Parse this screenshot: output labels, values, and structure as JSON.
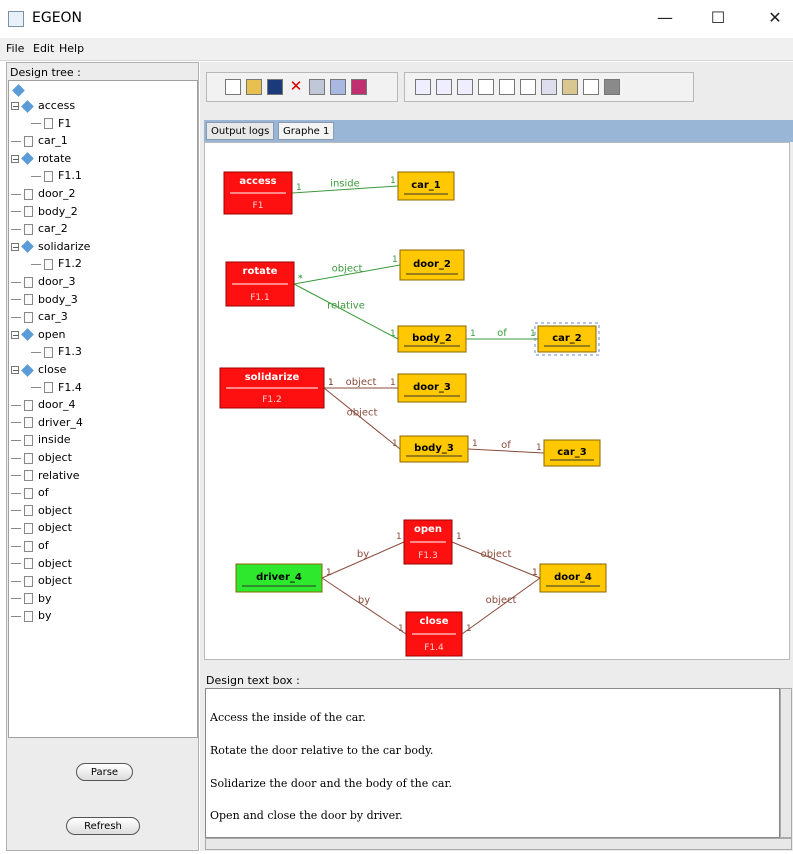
{
  "window": {
    "title": "EGEON",
    "minimize": "—",
    "maximize": "☐",
    "close": "✕"
  },
  "menu": {
    "file": "File",
    "edit": "Edit",
    "help": "Help"
  },
  "left": {
    "label": "Design tree :",
    "tree": [
      {
        "text": "access",
        "kind": "folder",
        "level": 1,
        "expanded": true
      },
      {
        "text": "F1",
        "kind": "doc",
        "level": 2
      },
      {
        "text": "car_1",
        "kind": "doc",
        "level": 1
      },
      {
        "text": "rotate",
        "kind": "folder",
        "level": 1,
        "expanded": true
      },
      {
        "text": "F1.1",
        "kind": "doc",
        "level": 2
      },
      {
        "text": "door_2",
        "kind": "doc",
        "level": 1
      },
      {
        "text": "body_2",
        "kind": "doc",
        "level": 1
      },
      {
        "text": "car_2",
        "kind": "doc",
        "level": 1
      },
      {
        "text": "solidarize",
        "kind": "folder",
        "level": 1,
        "expanded": true
      },
      {
        "text": "F1.2",
        "kind": "doc",
        "level": 2
      },
      {
        "text": "door_3",
        "kind": "doc",
        "level": 1
      },
      {
        "text": "body_3",
        "kind": "doc",
        "level": 1
      },
      {
        "text": "car_3",
        "kind": "doc",
        "level": 1
      },
      {
        "text": "open",
        "kind": "folder",
        "level": 1,
        "expanded": true
      },
      {
        "text": "F1.3",
        "kind": "doc",
        "level": 2
      },
      {
        "text": "close",
        "kind": "folder",
        "level": 1,
        "expanded": true
      },
      {
        "text": "F1.4",
        "kind": "doc",
        "level": 2
      },
      {
        "text": "door_4",
        "kind": "doc",
        "level": 1
      },
      {
        "text": "driver_4",
        "kind": "doc",
        "level": 1
      },
      {
        "text": "inside",
        "kind": "doc",
        "level": 1
      },
      {
        "text": "object",
        "kind": "doc",
        "level": 1
      },
      {
        "text": "relative",
        "kind": "doc",
        "level": 1
      },
      {
        "text": "of",
        "kind": "doc",
        "level": 1
      },
      {
        "text": "object",
        "kind": "doc",
        "level": 1
      },
      {
        "text": "object",
        "kind": "doc",
        "level": 1
      },
      {
        "text": "of",
        "kind": "doc",
        "level": 1
      },
      {
        "text": "object",
        "kind": "doc",
        "level": 1
      },
      {
        "text": "object",
        "kind": "doc",
        "level": 1
      },
      {
        "text": "by",
        "kind": "doc",
        "level": 1
      },
      {
        "text": "by",
        "kind": "doc",
        "level": 1
      }
    ],
    "parse_button": "Parse",
    "refresh_button": "Refresh"
  },
  "tabs": {
    "output_logs": "Output logs",
    "graphe": "Graphe 1"
  },
  "graph": {
    "nodes": [
      {
        "id": "access",
        "label": "access",
        "sub": "F1",
        "kind": "function"
      },
      {
        "id": "car_1",
        "label": "car_1",
        "kind": "object"
      },
      {
        "id": "rotate",
        "label": "rotate",
        "sub": "F1.1",
        "kind": "function"
      },
      {
        "id": "door_2",
        "label": "door_2",
        "kind": "object"
      },
      {
        "id": "body_2",
        "label": "body_2",
        "kind": "object"
      },
      {
        "id": "car_2",
        "label": "car_2",
        "kind": "object",
        "selected": true
      },
      {
        "id": "solidarize",
        "label": "solidarize",
        "sub": "F1.2",
        "kind": "function"
      },
      {
        "id": "door_3",
        "label": "door_3",
        "kind": "object"
      },
      {
        "id": "body_3",
        "label": "body_3",
        "kind": "object"
      },
      {
        "id": "car_3",
        "label": "car_3",
        "kind": "object"
      },
      {
        "id": "open",
        "label": "open",
        "sub": "F1.3",
        "kind": "function"
      },
      {
        "id": "driver_4",
        "label": "driver_4",
        "kind": "actor"
      },
      {
        "id": "door_4",
        "label": "door_4",
        "kind": "object"
      },
      {
        "id": "close",
        "label": "close",
        "sub": "F1.4",
        "kind": "function"
      }
    ],
    "edges": [
      {
        "from": "access",
        "to": "car_1",
        "label": "inside",
        "m1": "1",
        "m2": "1",
        "color": "green"
      },
      {
        "from": "rotate",
        "to": "door_2",
        "label": "object",
        "m1": "*",
        "m2": "1",
        "color": "green"
      },
      {
        "from": "rotate",
        "to": "body_2",
        "label": "relative",
        "m1": "*",
        "m2": "1",
        "color": "green"
      },
      {
        "from": "body_2",
        "to": "car_2",
        "label": "of",
        "m1": "1",
        "m2": "1",
        "color": "green"
      },
      {
        "from": "solidarize",
        "to": "door_3",
        "label": "object",
        "m1": "1",
        "m2": "1",
        "color": "brown"
      },
      {
        "from": "solidarize",
        "to": "body_3",
        "label": "object",
        "m1": "1",
        "m2": "1",
        "color": "brown"
      },
      {
        "from": "body_3",
        "to": "car_3",
        "label": "of",
        "m1": "1",
        "m2": "1",
        "color": "brown"
      },
      {
        "from": "driver_4",
        "to": "open",
        "label": "by",
        "m1": "1",
        "m2": "1",
        "color": "brown"
      },
      {
        "from": "open",
        "to": "door_4",
        "label": "object",
        "m1": "1",
        "m2": "1",
        "color": "brown"
      },
      {
        "from": "driver_4",
        "to": "close",
        "label": "by",
        "m1": "1",
        "m2": "1",
        "color": "brown"
      },
      {
        "from": "close",
        "to": "door_4",
        "label": "object",
        "m1": "1",
        "m2": "1",
        "color": "brown"
      }
    ],
    "colors": {
      "function": "#ff1010",
      "object": "#ffc800",
      "actor": "#2ee82e",
      "green_edge": "#3a9a3a",
      "brown_edge": "#8a4a3a"
    }
  },
  "design_text": {
    "label": "Design text box :",
    "lines": [
      "Access the inside of the car.",
      "Rotate the door relative to the car body.",
      "Solidarize the door and the body of the car.",
      "Open and close the door by driver."
    ]
  }
}
